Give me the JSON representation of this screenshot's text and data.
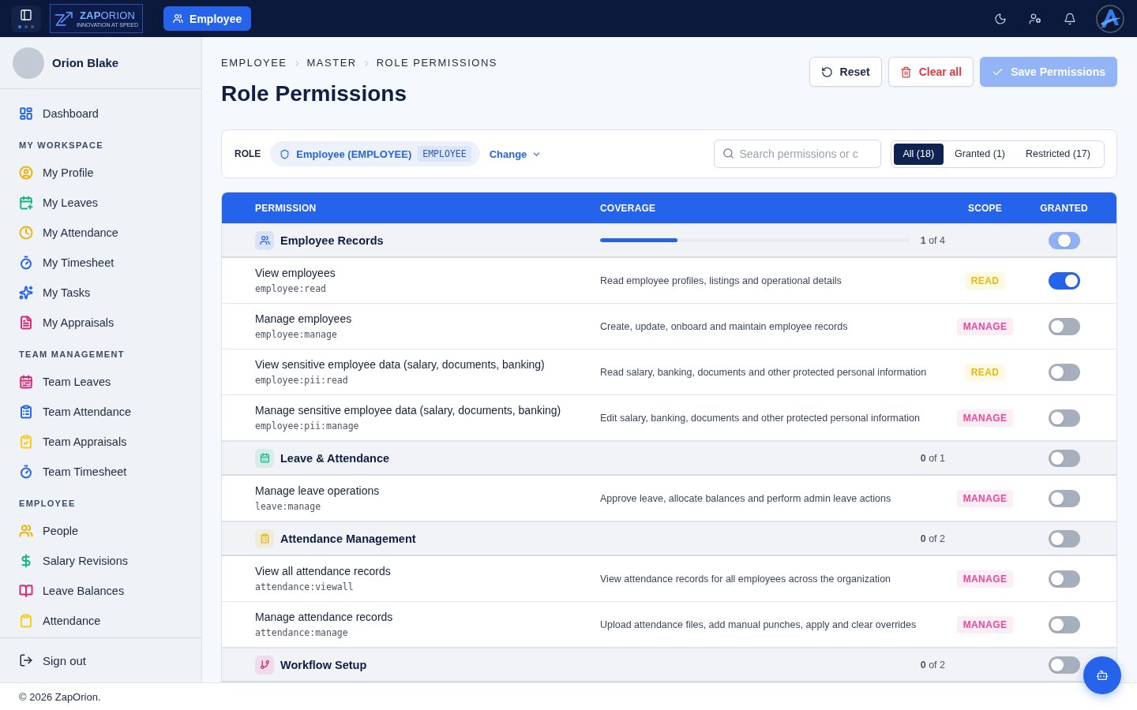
{
  "topbar": {
    "logo": {
      "wordmark": "**ZAP**ORION",
      "tagline": "INNOVATION AT SPEED"
    },
    "module_button": {
      "label": "Employee"
    }
  },
  "sidebar": {
    "user": {
      "name": "Orion Blake"
    },
    "items": [
      {
        "label": "Dashboard",
        "color": "#2563eb"
      }
    ],
    "sections": [
      {
        "title": "MY WORKSPACE",
        "items": [
          {
            "label": "My Profile",
            "color": "#eab308"
          },
          {
            "label": "My Leaves",
            "color": "#10b981"
          },
          {
            "label": "My Attendance",
            "color": "#eab308"
          },
          {
            "label": "My Timesheet",
            "color": "#2563eb"
          },
          {
            "label": "My Tasks",
            "color": "#2563eb"
          },
          {
            "label": "My Appraisals",
            "color": "#db2777"
          }
        ]
      },
      {
        "title": "TEAM MANAGEMENT",
        "items": [
          {
            "label": "Team Leaves",
            "color": "#db2777"
          },
          {
            "label": "Team Attendance",
            "color": "#2563eb"
          },
          {
            "label": "Team Appraisals",
            "color": "#facc15"
          },
          {
            "label": "Team Timesheet",
            "color": "#2563eb"
          }
        ]
      },
      {
        "title": "EMPLOYEE",
        "items": [
          {
            "label": "People",
            "color": "#eab308"
          },
          {
            "label": "Salary Revisions",
            "color": "#10b981"
          },
          {
            "label": "Leave Balances",
            "color": "#db2777"
          },
          {
            "label": "Attendance",
            "color": "#facc15"
          }
        ]
      }
    ],
    "sign_out": {
      "label": "Sign out"
    }
  },
  "breadcrumb": [
    "EMPLOYEE",
    "MASTER",
    "ROLE PERMISSIONS"
  ],
  "title": "Role Permissions",
  "actions": [
    {
      "label": "Reset",
      "kind": "reset",
      "disabled": false
    },
    {
      "label": "Clear all",
      "kind": "clear",
      "disabled": false
    },
    {
      "label": "Save Permissions",
      "kind": "save",
      "disabled": true
    }
  ],
  "role": {
    "label": "ROLE",
    "name": "Employee (EMPLOYEE)",
    "code": "EMPLOYEE",
    "change": "Change"
  },
  "search": {
    "placeholder": "Search permissions or c"
  },
  "filters": [
    {
      "label": "All (18)",
      "selected": true
    },
    {
      "label": "Granted (1)",
      "selected": false
    },
    {
      "label": "Restricted (17)",
      "selected": false
    }
  ],
  "table": {
    "columns": [
      "PERMISSION",
      "COVERAGE",
      "SCOPE",
      "GRANTED"
    ],
    "groups": [
      {
        "name": "Employee Records",
        "color": "#2563eb",
        "level": 0.25,
        "count": "**1** of 4",
        "granted": false,
        "indeterminate": true,
        "rows": [
          {
            "title": "View employees",
            "code": "employee:read",
            "description": "Read employee profiles, listings and operational details",
            "scope": {
              "label": "READ",
              "kind": "read"
            },
            "granted": true
          },
          {
            "title": "Manage employees",
            "code": "employee:manage",
            "description": "Create, update, onboard and maintain employee records",
            "scope": {
              "label": "MANAGE",
              "kind": "manage"
            },
            "granted": false
          },
          {
            "title": "View sensitive employee data (salary, documents, banking)",
            "code": "employee:pii:read",
            "description": "Read salary, banking, documents and other protected personal information",
            "scope": {
              "label": "READ",
              "kind": "read"
            },
            "granted": false
          },
          {
            "title": "Manage sensitive employee data (salary, documents, banking)",
            "code": "employee:pii:manage",
            "description": "Edit salary, banking, documents and other protected personal information",
            "scope": {
              "label": "MANAGE",
              "kind": "manage"
            },
            "granted": false
          }
        ]
      },
      {
        "name": "Leave & Attendance",
        "color": "#10b981",
        "count": "**0** of 1",
        "granted": false,
        "indeterminate": false,
        "rows": [
          {
            "title": "Manage leave operations",
            "code": "leave:manage",
            "description": "Approve leave, allocate balances and perform admin leave actions",
            "scope": {
              "label": "MANAGE",
              "kind": "manage"
            },
            "granted": false
          }
        ]
      },
      {
        "name": "Attendance Management",
        "color": "#eab308",
        "count": "**0** of 2",
        "granted": false,
        "indeterminate": false,
        "rows": [
          {
            "title": "View all attendance records",
            "code": "attendance:viewall",
            "description": "View attendance records for all employees across the organization",
            "scope": {
              "label": "MANAGE",
              "kind": "manage"
            },
            "granted": false
          },
          {
            "title": "Manage attendance records",
            "code": "attendance:manage",
            "description": "Upload attendance files, add manual punches, apply and clear overrides",
            "scope": {
              "label": "MANAGE",
              "kind": "manage"
            },
            "granted": false
          }
        ]
      },
      {
        "name": "Workflow Setup",
        "color": "#db2777",
        "count": "**0** of 2",
        "granted": false,
        "indeterminate": false
      }
    ]
  },
  "footer": {
    "text": "© 2026 ZapOrion."
  }
}
